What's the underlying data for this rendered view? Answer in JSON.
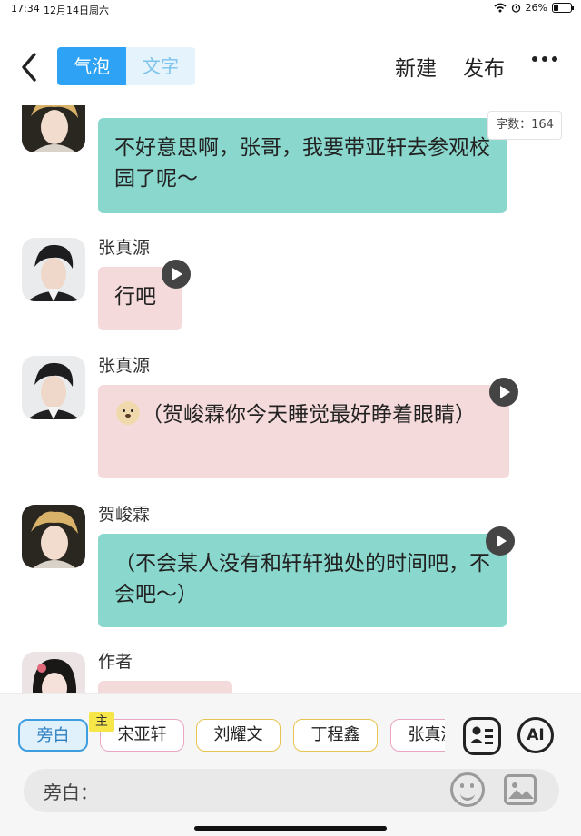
{
  "status_bar": {
    "time": "17:34",
    "date": "12月14日周六",
    "battery": "26%",
    "battery_level": 0.26
  },
  "header": {
    "tabs": [
      {
        "label": "气泡",
        "active": true
      },
      {
        "label": "文字",
        "active": false
      }
    ],
    "new_label": "新建",
    "publish_label": "发布"
  },
  "word_count": "字数：164",
  "messages": [
    {
      "sender": "",
      "text": "不好意思啊，张哥，我要带亚轩去参观校园了呢～",
      "color": "#8ad7cd",
      "has_play": false
    },
    {
      "sender": "张真源",
      "text": "行吧",
      "color": "#f5dadb",
      "has_play": true
    },
    {
      "sender": "张真源",
      "text": "（贺峻霖你今天睡觉最好睁着眼睛）",
      "color": "#f5dadb",
      "has_play": true
    },
    {
      "sender": "贺峻霖",
      "text": "（不会某人没有和轩轩独处的时间吧，不会吧～）",
      "color": "#8ad7cd",
      "has_play": true
    },
    {
      "sender": "作者",
      "text": "",
      "color": "#f5dadb",
      "has_play": false
    }
  ],
  "characters": [
    "旁白",
    "宋亚轩",
    "刘耀文",
    "丁程鑫",
    "张真源"
  ],
  "host_badge": "主",
  "ai_label": "AI",
  "input": {
    "prefix": "旁白："
  },
  "colors": {
    "accent": "#2ea3f5",
    "bubble_teal": "#8ad7cd",
    "bubble_pink": "#f5dadb"
  }
}
